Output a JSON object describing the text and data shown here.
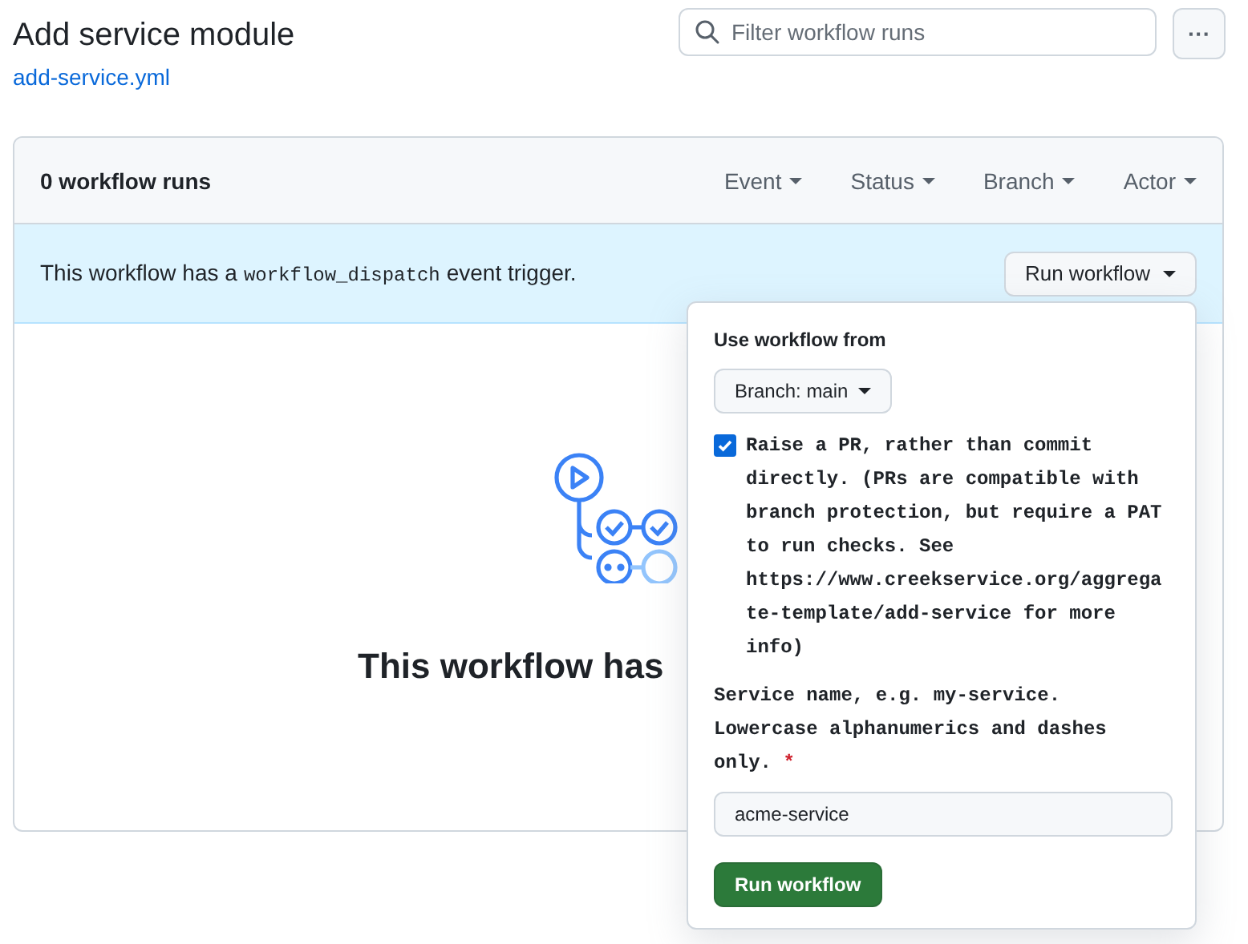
{
  "header": {
    "title": "Add service module",
    "file_link": "add-service.yml",
    "search": {
      "placeholder": "Filter workflow runs"
    },
    "more_button": "···"
  },
  "runs_box": {
    "count": "0 workflow runs",
    "filters": [
      "Event",
      "Status",
      "Branch",
      "Actor"
    ],
    "banner": {
      "text_before": "This workflow has a",
      "code": "workflow_dispatch",
      "text_after": "event trigger.",
      "button": "Run workflow"
    },
    "empty_heading": "This workflow has"
  },
  "popover": {
    "title": "Use workflow from",
    "branch_button": "Branch: main",
    "checkbox": {
      "label": "Raise a PR, rather than commit directly. (PRs are compatible with branch protection, but require a PAT to run checks. See https://www.creekservice.org/aggregate-template/add-service for more info)",
      "checked": true
    },
    "service_field": {
      "label": "Service name, e.g. my-service. Lowercase alphanumerics and dashes only.",
      "required_mark": "*",
      "value": "acme-service"
    },
    "submit": "Run workflow"
  }
}
